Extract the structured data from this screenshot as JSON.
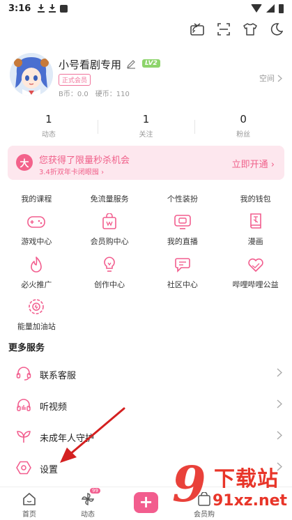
{
  "status_bar": {
    "time": "3:16"
  },
  "profile": {
    "username": "小号看剧专用",
    "level": "LV2",
    "member_badge": "正式会员",
    "bcoin_label": "B币：",
    "bcoin_value": "0.0",
    "coins_label": "硬币：",
    "coins_value": "110",
    "space_link": "空间"
  },
  "stats": [
    {
      "count": "1",
      "label": "动态"
    },
    {
      "count": "1",
      "label": "关注"
    },
    {
      "count": "0",
      "label": "粉丝"
    }
  ],
  "vip_banner": {
    "icon_text": "大",
    "title": "您获得了限量秒杀机会",
    "subtitle": "3.4折双年卡闭眼囤 ›",
    "cta": "立即开通"
  },
  "quick_links": [
    "我的课程",
    "免流量服务",
    "个性装扮",
    "我的钱包"
  ],
  "services": [
    {
      "label": "游戏中心",
      "icon": "gamepad-icon"
    },
    {
      "label": "会员购中心",
      "icon": "shopping-bag-icon"
    },
    {
      "label": "我的直播",
      "icon": "tv-icon"
    },
    {
      "label": "漫画",
      "icon": "comic-book-icon"
    },
    {
      "label": "必火推广",
      "icon": "flame-icon"
    },
    {
      "label": "创作中心",
      "icon": "lightbulb-icon"
    },
    {
      "label": "社区中心",
      "icon": "chat-icon"
    },
    {
      "label": "哔哩哔哩公益",
      "icon": "heart-hands-icon"
    },
    {
      "label": "能量加油站",
      "icon": "energy-station-icon"
    }
  ],
  "more_services": {
    "title": "更多服务",
    "items": [
      {
        "label": "联系客服",
        "icon": "headset-icon"
      },
      {
        "label": "听视频",
        "icon": "headphones-icon"
      },
      {
        "label": "未成年人守护",
        "icon": "sprout-icon"
      },
      {
        "label": "设置",
        "icon": "settings-hexagon-icon"
      }
    ]
  },
  "bottom_nav": {
    "home": "首页",
    "dynamic": "动态",
    "dynamic_badge": "99",
    "member_shop": "会员购"
  },
  "watermark": {
    "big": "9",
    "text": "下载站",
    "url": "91xz.net"
  },
  "colors": {
    "accent": "#f25d8e",
    "banner_bg": "#fde7ee",
    "level_green": "#8dd46b",
    "annotation_red": "#d42020"
  }
}
